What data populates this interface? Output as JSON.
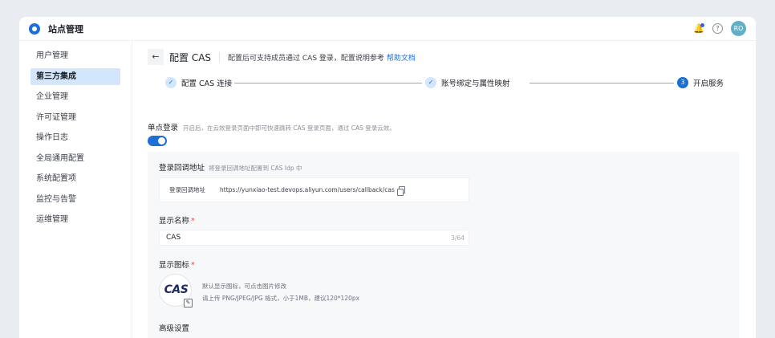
{
  "app": {
    "title": "站点管理",
    "avatar": "RO"
  },
  "sidebar": {
    "items": [
      {
        "label": "用户管理",
        "active": false
      },
      {
        "label": "第三方集成",
        "active": true
      },
      {
        "label": "企业管理",
        "active": false
      },
      {
        "label": "许可证管理",
        "active": false
      },
      {
        "label": "操作日志",
        "active": false
      },
      {
        "label": "全局通用配置",
        "active": false
      },
      {
        "label": "系统配置项",
        "active": false
      },
      {
        "label": "监控与告警",
        "active": false
      },
      {
        "label": "运维管理",
        "active": false
      }
    ]
  },
  "header": {
    "title": "配置 CAS",
    "desc": "配置后可支持成员通过 CAS 登录，配置说明参考",
    "help_link": "帮助文档"
  },
  "steps": [
    {
      "label": "配置 CAS 连接",
      "status": "done"
    },
    {
      "label": "账号绑定与属性映射",
      "status": "done"
    },
    {
      "number": "3",
      "label": "开启服务",
      "status": "current"
    }
  ],
  "sso": {
    "label": "单点登录",
    "desc": "开启后，在云效登录页面中即可快速跳转 CAS 登录页面，通过 CAS 登录云效。",
    "enabled": true
  },
  "callback": {
    "title": "登录回调地址",
    "hint": "将登录回调地址配置到 CAS Idp 中",
    "label": "登录回调地址",
    "url": "https://yunxiao-test.devops.aliyun.com/users/callback/cas"
  },
  "display_name": {
    "title": "显示名称",
    "required": "*",
    "value": "CAS",
    "count": "3/64"
  },
  "display_icon": {
    "title": "显示图标",
    "required": "*",
    "logo_text": "CAS",
    "desc1": "默认显示图标，可点击图片修改",
    "desc2": "请上传 PNG/JPEG/JPG 格式，小于1MB，建议120*120px"
  },
  "advanced": {
    "title": "高级设置"
  },
  "colors": {
    "primary": "#1b6fd6",
    "active_bg": "#d4e6fb",
    "panel_bg": "#f7f8fa"
  }
}
